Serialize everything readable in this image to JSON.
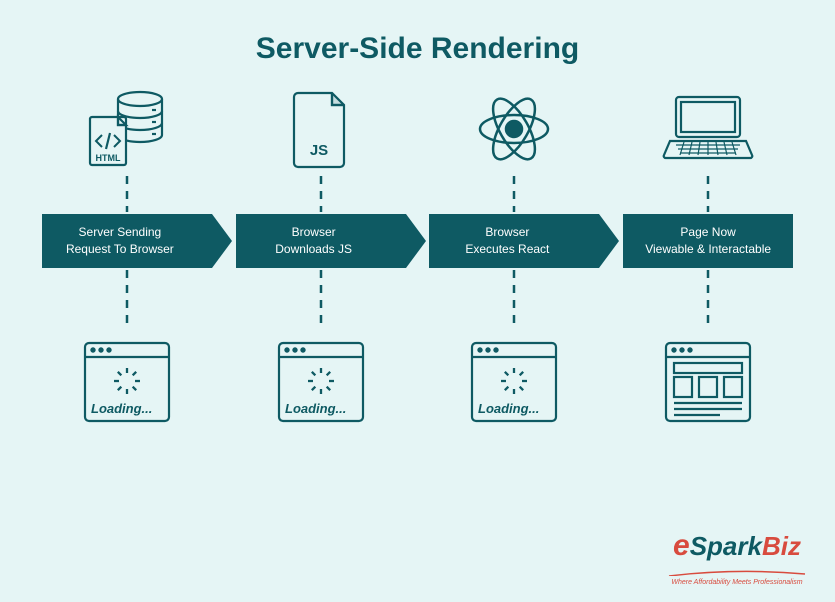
{
  "title": "Server-Side Rendering",
  "steps": [
    {
      "label": "Server Sending\nRequest To Browser",
      "loading_text": "Loading..."
    },
    {
      "label": "Browser\nDownloads JS",
      "loading_text": "Loading..."
    },
    {
      "label": "Browser\nExecutes React",
      "loading_text": "Loading..."
    },
    {
      "label": "Page Now\nViewable & Interactable",
      "loading_text": ""
    }
  ],
  "icons": {
    "html_label": "HTML",
    "js_label": "JS"
  },
  "logo": {
    "brand": "eSparkBiz",
    "tagline": "Where Affordability Meets Professionalism"
  },
  "colors": {
    "primary": "#0e5a63",
    "accent": "#d84b3e",
    "bg": "#e5f5f5"
  }
}
